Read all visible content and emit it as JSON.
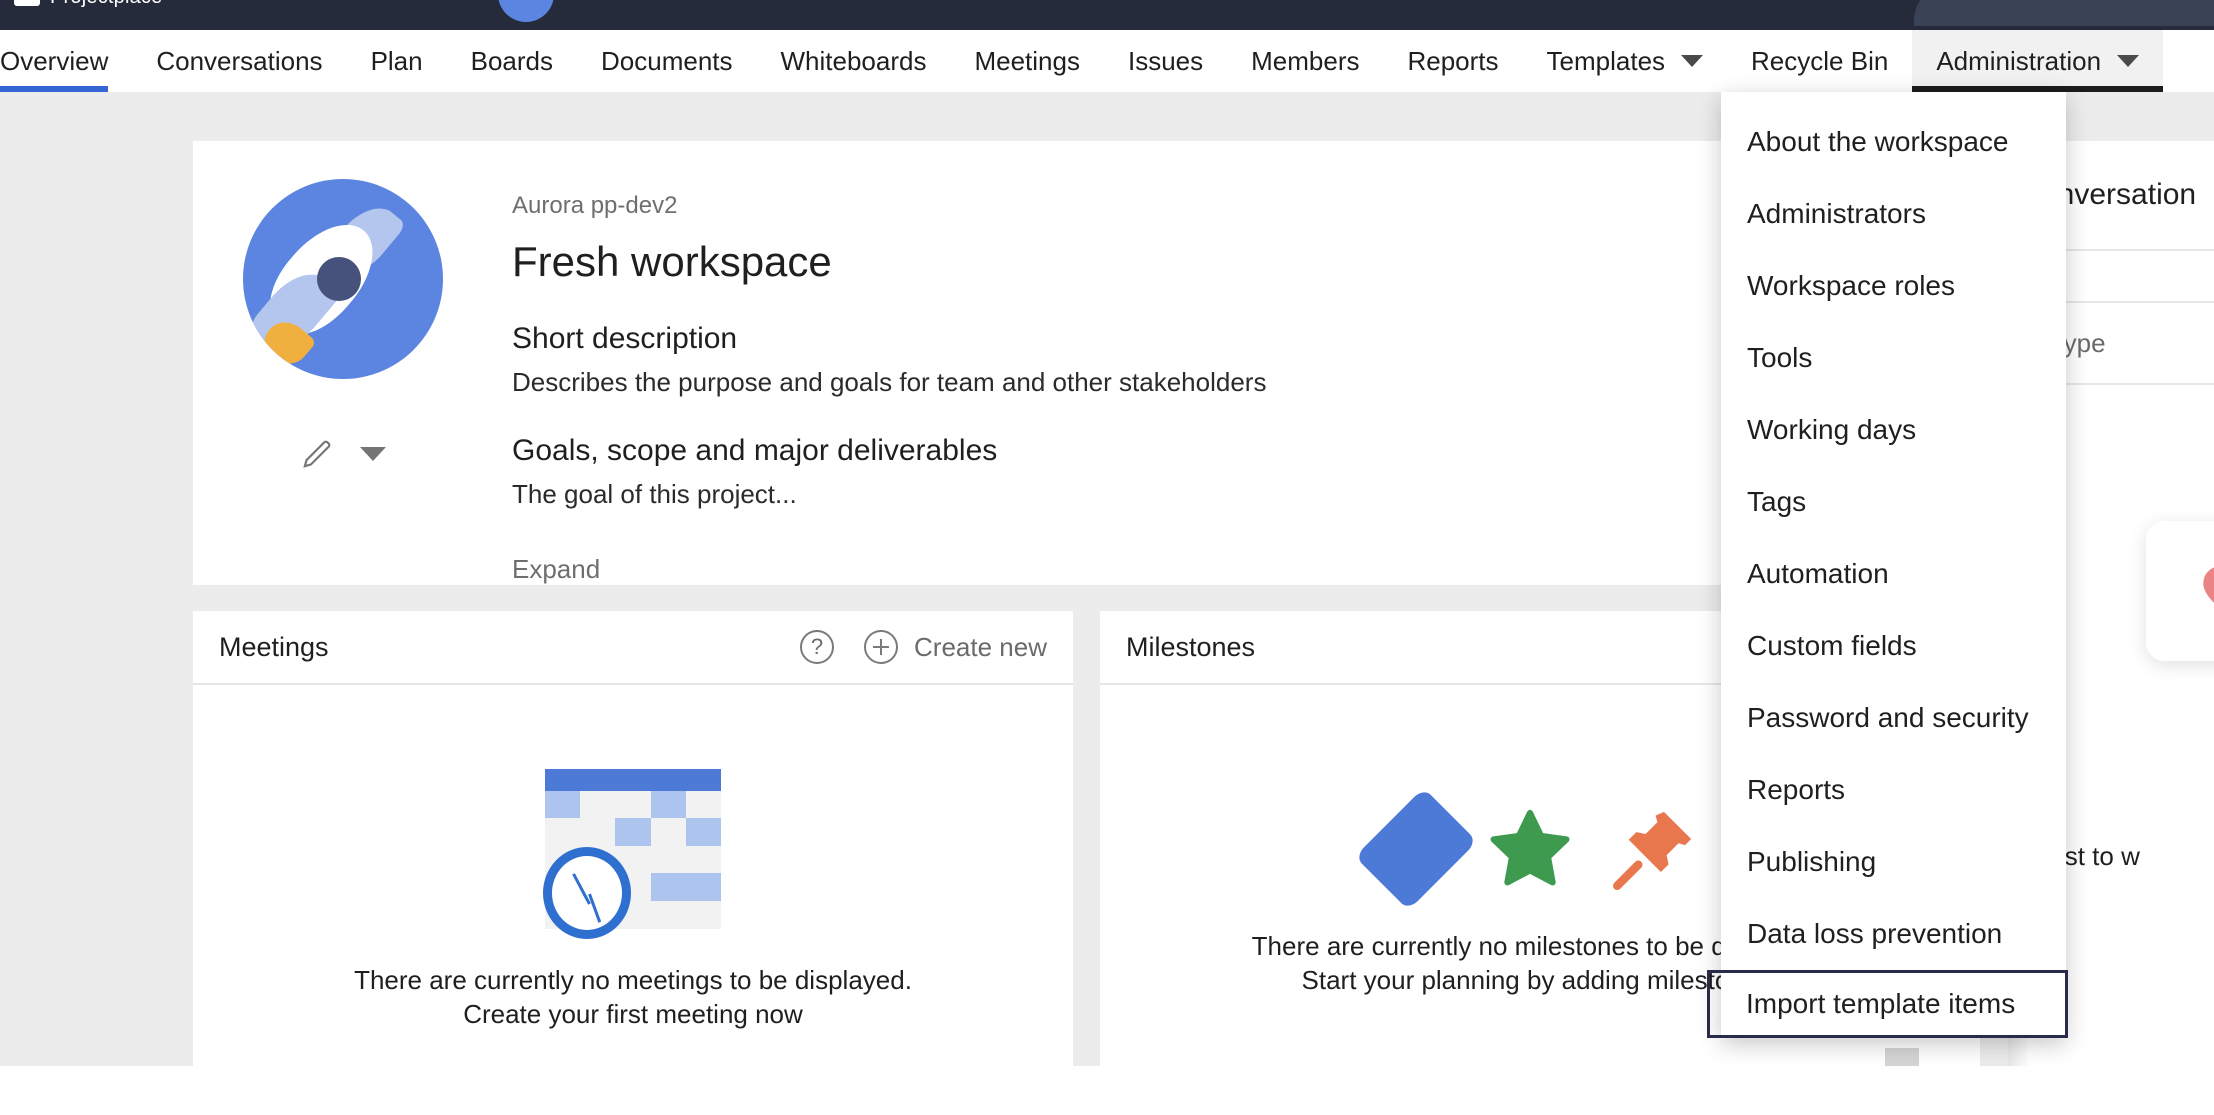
{
  "topbar": {
    "brand": "Projectplace"
  },
  "nav": {
    "items": [
      {
        "label": "Overview",
        "state": "active",
        "caret": false
      },
      {
        "label": "Conversations",
        "state": "",
        "caret": false
      },
      {
        "label": "Plan",
        "state": "",
        "caret": false
      },
      {
        "label": "Boards",
        "state": "",
        "caret": false
      },
      {
        "label": "Documents",
        "state": "",
        "caret": false
      },
      {
        "label": "Whiteboards",
        "state": "",
        "caret": false
      },
      {
        "label": "Meetings",
        "state": "",
        "caret": false
      },
      {
        "label": "Issues",
        "state": "",
        "caret": false
      },
      {
        "label": "Members",
        "state": "",
        "caret": false
      },
      {
        "label": "Reports",
        "state": "",
        "caret": false
      },
      {
        "label": "Templates",
        "state": "",
        "caret": true
      },
      {
        "label": "Recycle Bin",
        "state": "",
        "caret": false
      },
      {
        "label": "Administration",
        "state": "open",
        "caret": true
      }
    ]
  },
  "dropdown": {
    "items": [
      {
        "label": "About the workspace",
        "highlighted": false
      },
      {
        "label": "Administrators",
        "highlighted": false
      },
      {
        "label": "Workspace roles",
        "highlighted": false
      },
      {
        "label": "Tools",
        "highlighted": false
      },
      {
        "label": "Working days",
        "highlighted": false
      },
      {
        "label": "Tags",
        "highlighted": false
      },
      {
        "label": "Automation",
        "highlighted": false
      },
      {
        "label": "Custom fields",
        "highlighted": false
      },
      {
        "label": "Password and security",
        "highlighted": false
      },
      {
        "label": "Reports",
        "highlighted": false
      },
      {
        "label": "Publishing",
        "highlighted": false
      },
      {
        "label": "Data loss prevention",
        "highlighted": false
      },
      {
        "label": "Import template items",
        "highlighted": true
      }
    ]
  },
  "workspace": {
    "breadcrumb": "Aurora pp-dev2",
    "title": "Fresh workspace",
    "short_description_label": "Short description",
    "short_description_text": "Describes the purpose and goals for team and other stakeholders",
    "goals_label": "Goals, scope and major deliverables",
    "goals_text": "The goal of this project...",
    "expand_label": "Expand",
    "avatar_icon": "rocket-icon",
    "edit_icon": "pencil-icon",
    "edit_caret_icon": "chevron-down-icon"
  },
  "cards": {
    "meetings": {
      "title": "Meetings",
      "help_icon": "question-mark-icon",
      "create_icon": "plus-circle-icon",
      "create_label": "Create new",
      "empty_text": "There are currently no meetings to be displayed. Create your first meeting now",
      "illustration": "calendar-clock-icon"
    },
    "milestones": {
      "title": "Milestones",
      "help_icon": "question-mark-icon",
      "empty_text": "There are currently no milestones to be displayed. Start your planning by adding milestones.",
      "illustration": "diamond-star-pin-icon"
    }
  },
  "right_panel": {
    "header_fragment": "conversation",
    "subtext_fragment": "nent and type",
    "message_fragment": "e the first to w",
    "tile_icon": "heart-icon"
  },
  "colors": {
    "topbar_bg": "#252b3a",
    "accent_blue": "#3665d6",
    "page_bg": "#ececec",
    "card_bg": "#ffffff",
    "highlight_border": "#2a2a4a",
    "milestone_diamond": "#4c7ad6",
    "milestone_star": "#3d9a4e",
    "milestone_pin": "#e8774e",
    "heart": "#ea8383"
  }
}
